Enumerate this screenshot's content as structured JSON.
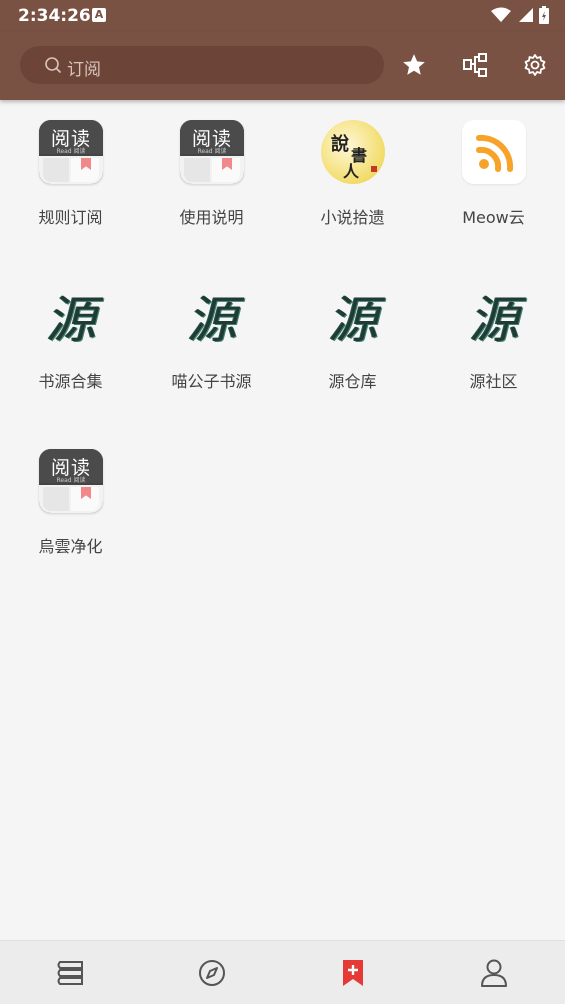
{
  "status_bar": {
    "time": "2:34:26",
    "notification_icon": "A"
  },
  "search": {
    "placeholder": "订阅"
  },
  "toolbar": {
    "actions": [
      "star-icon",
      "rule-subscription-icon",
      "settings-icon"
    ]
  },
  "subscriptions": [
    {
      "label": "规则订阅",
      "icon": "read-app-icon"
    },
    {
      "label": "使用说明",
      "icon": "read-app-icon"
    },
    {
      "label": "小说拾遗",
      "icon": "storyteller-icon"
    },
    {
      "label": "Meow云",
      "icon": "rss-icon"
    },
    {
      "label": "书源合集",
      "icon": "yuan-calligraphy-icon"
    },
    {
      "label": "喵公子书源",
      "icon": "yuan-calligraphy-icon"
    },
    {
      "label": "源仓库",
      "icon": "yuan-calligraphy-icon"
    },
    {
      "label": "源社区",
      "icon": "yuan-calligraphy-icon"
    },
    {
      "label": "烏雲净化",
      "icon": "read-app-icon"
    }
  ],
  "read_icon": {
    "title": "阅读",
    "subtitle": "Read 阅读"
  },
  "storyteller_icon": {
    "chars": [
      "說",
      "書",
      "人"
    ]
  },
  "yuan_icon": {
    "char": "源"
  },
  "bottom_nav": {
    "items": [
      "bookshelf-icon",
      "explore-icon",
      "subscription-icon",
      "profile-icon"
    ],
    "active_index": 2
  },
  "colors": {
    "app_bar": "#7a5244",
    "accent": "#e53935",
    "background": "#f5f5f5"
  }
}
